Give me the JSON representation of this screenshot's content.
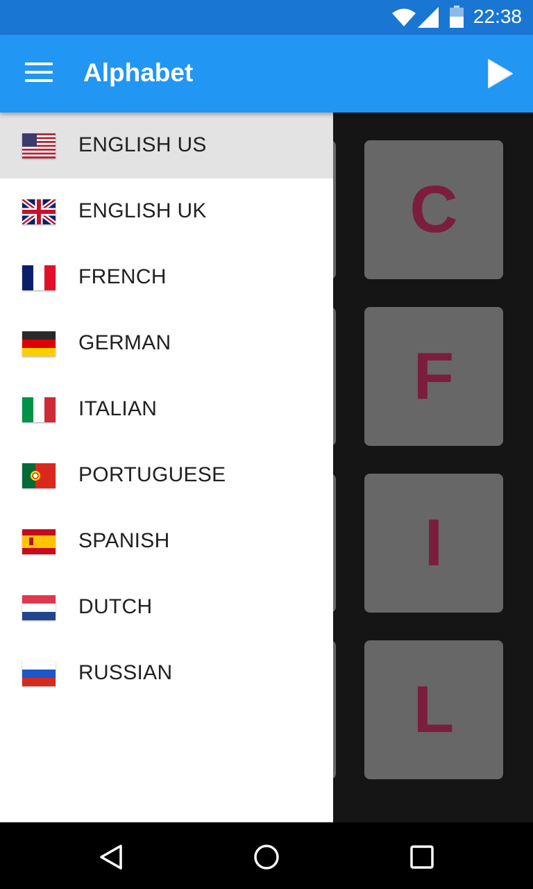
{
  "status_bar": {
    "time": "22:38",
    "icons": [
      "wifi-icon",
      "signal-icon",
      "battery-icon"
    ],
    "color": "#1976D2"
  },
  "app_bar": {
    "title": "Alphabet",
    "menu_icon": "hamburger-menu-icon",
    "action_icon": "play-icon",
    "color": "#2196F3"
  },
  "drawer": {
    "items": [
      {
        "label": "ENGLISH US",
        "flag": "us-flag-icon",
        "selected": true
      },
      {
        "label": "ENGLISH UK",
        "flag": "uk-flag-icon",
        "selected": false
      },
      {
        "label": "FRENCH",
        "flag": "france-flag-icon",
        "selected": false
      },
      {
        "label": "GERMAN",
        "flag": "germany-flag-icon",
        "selected": false
      },
      {
        "label": "ITALIAN",
        "flag": "italy-flag-icon",
        "selected": false
      },
      {
        "label": "PORTUGUESE",
        "flag": "portugal-flag-icon",
        "selected": false
      },
      {
        "label": "SPANISH",
        "flag": "spain-flag-icon",
        "selected": false
      },
      {
        "label": "DUTCH",
        "flag": "netherlands-flag-icon",
        "selected": false
      },
      {
        "label": "RUSSIAN",
        "flag": "russia-flag-icon",
        "selected": false
      }
    ]
  },
  "letter_tiles": {
    "letters": [
      "C",
      "F",
      "I",
      "L"
    ],
    "tile_color": "#676767",
    "letter_color": "#7B1E3E"
  },
  "nav_bar": {
    "icons": [
      "back-icon",
      "home-icon",
      "recents-icon"
    ]
  }
}
